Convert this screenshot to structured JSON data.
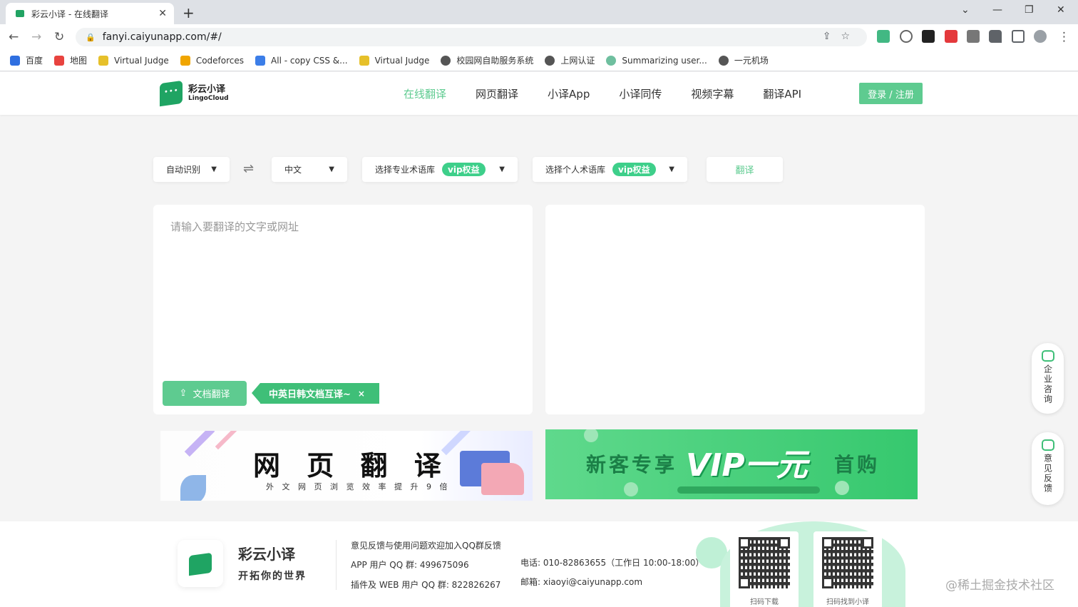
{
  "browser": {
    "tab_title": "彩云小译 - 在线翻译",
    "tab_close": "✕",
    "new_tab": "+",
    "url": "fanyi.caiyunapp.com/#/",
    "window_controls": [
      "⌄",
      "—",
      "❐",
      "✕"
    ],
    "bookmarks": [
      {
        "label": "百度",
        "color": "#2f6fe0"
      },
      {
        "label": "地图",
        "color": "#e8433f"
      },
      {
        "label": "Virtual Judge",
        "color": "#e6c02a"
      },
      {
        "label": "Codeforces",
        "color": "#f0a500"
      },
      {
        "label": "All - copy CSS &...",
        "color": "#3c7ee8"
      },
      {
        "label": "Virtual Judge",
        "color": "#e6c02a"
      },
      {
        "label": "校园网自助服务系统",
        "color": "#555555"
      },
      {
        "label": "上网认证",
        "color": "#555555"
      },
      {
        "label": "Summarizing user...",
        "color": "#6fbf9f"
      },
      {
        "label": "一元机场",
        "color": "#555555"
      }
    ]
  },
  "header": {
    "logo_cn": "彩云小译",
    "logo_en": "LingoCloud",
    "nav": [
      "在线翻译",
      "网页翻译",
      "小译App",
      "小译同传",
      "视频字幕",
      "翻译API"
    ],
    "login": "登录 / 注册"
  },
  "toolbar": {
    "source_lang": "自动识别",
    "target_lang": "中文",
    "pro_glossary": "选择专业术语库",
    "personal_glossary": "选择个人术语库",
    "vip_badge": "vip权益",
    "translate": "翻译",
    "caret": "▼",
    "swap": "⇌"
  },
  "editor": {
    "placeholder": "请输入要翻译的文字或网址",
    "doc_button": "文档翻译",
    "promo": "中英日韩文档互译~",
    "promo_close": "×"
  },
  "banners": {
    "web_title": "网 页 翻 译",
    "web_sub": "外 文 网 页 浏 览 效 率 提 升 9 倍",
    "vip_left": "新客专享",
    "vip_mid": "VIP一元",
    "vip_right": "首购"
  },
  "float": {
    "consult": "企业咨询",
    "feedback": "意见反馈"
  },
  "footer": {
    "brand": "彩云小译",
    "slogan": "开拓你的世界",
    "feedback_line": "意见反馈与使用问题欢迎加入QQ群反馈",
    "app_qq": "APP 用户 QQ 群: 499675096",
    "web_qq": "插件及 WEB 用户 QQ 群: 822826267",
    "phone": "电话: 010-82863655（工作日 10:00-18:00）",
    "email": "邮箱: xiaoyi@caiyunapp.com",
    "qr1_caption": "扫码下载",
    "qr2_caption": "扫码找到小译",
    "watermark": "@稀土掘金技术社区"
  }
}
